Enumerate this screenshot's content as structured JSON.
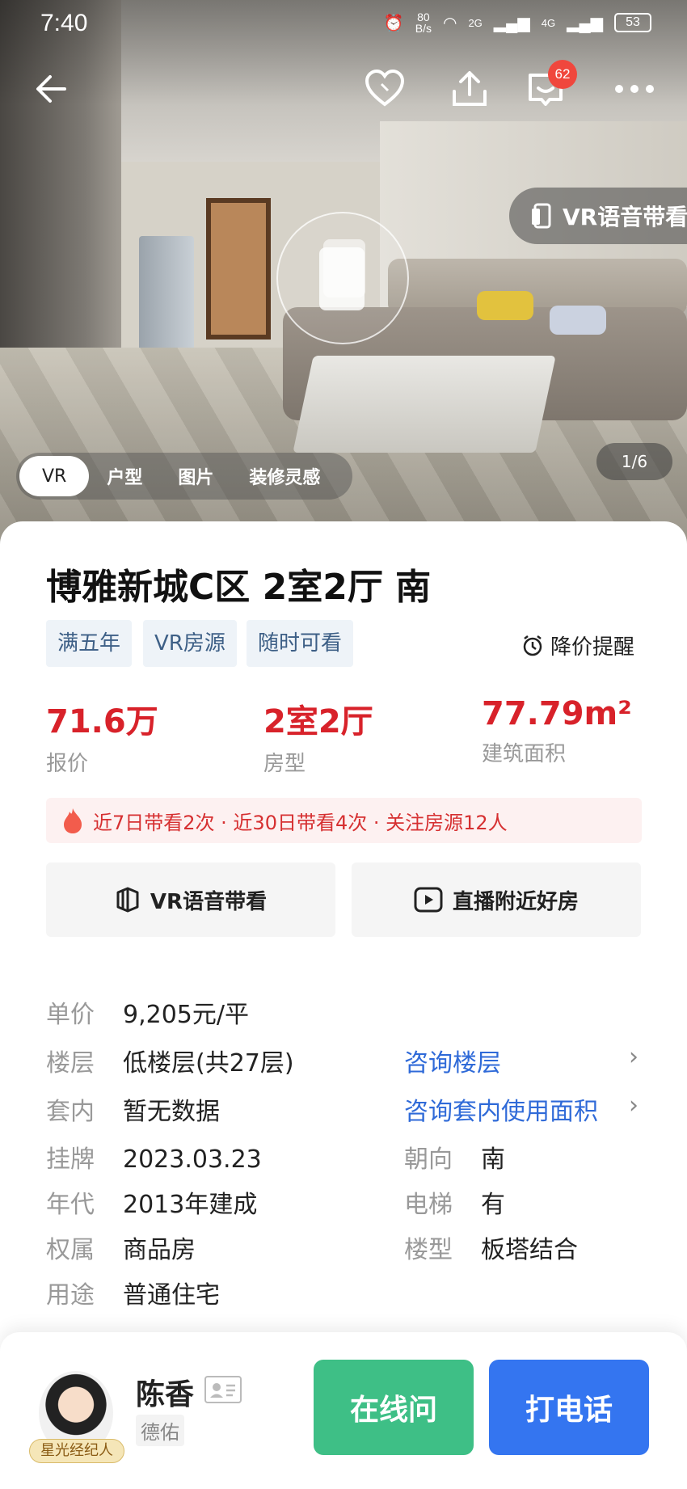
{
  "status_bar": {
    "time": "7:40",
    "net_speed": "80",
    "net_unit": "B/s",
    "signal1": "2G",
    "signal2": "4G",
    "battery": "53"
  },
  "nav": {
    "message_badge": "62",
    "icons": [
      "back-arrow-icon",
      "heart-icon",
      "share-icon",
      "message-icon",
      "more-icon"
    ]
  },
  "hero": {
    "vr_voice_label": "VR语音带看",
    "media_tabs": [
      "VR",
      "户型",
      "图片",
      "装修灵感"
    ],
    "page_indicator": "1/6"
  },
  "listing": {
    "title": "博雅新城C区 2室2厅 南",
    "tags": [
      "满五年",
      "VR房源",
      "随时可看"
    ],
    "price_alert": "降价提醒",
    "stats": [
      {
        "value": "71.6万",
        "label": "报价"
      },
      {
        "value": "2室2厅",
        "label": "房型"
      },
      {
        "value": "77.79m²",
        "label": "建筑面积"
      }
    ],
    "hot_info": "近7日带看2次 · 近30日带看4次 · 关注房源12人",
    "actions": [
      "VR语音带看",
      "直播附近好房"
    ],
    "details": {
      "unit_price": {
        "key": "单价",
        "value": "9,205元/平"
      },
      "floor": {
        "key": "楼层",
        "value": "低楼层(共27层)",
        "link": "咨询楼层"
      },
      "inner_area": {
        "key": "套内",
        "value": "暂无数据",
        "link": "咨询套内使用面积"
      },
      "listed": {
        "key": "挂牌",
        "value": "2023.03.23"
      },
      "orientation": {
        "key": "朝向",
        "value": "南"
      },
      "year": {
        "key": "年代",
        "value": "2013年建成"
      },
      "elevator": {
        "key": "电梯",
        "value": "有"
      },
      "ownership": {
        "key": "权属",
        "value": "商品房"
      },
      "building_type": {
        "key": "楼型",
        "value": "板塔结合"
      },
      "usage": {
        "key": "用途",
        "value": "普通住宅"
      }
    }
  },
  "agent": {
    "name": "陈香",
    "agency": "德佑",
    "badge": "星光经纪人",
    "chat_button": "在线问",
    "call_button": "打电话"
  },
  "colors": {
    "price_red": "#d8222a",
    "link_blue": "#2f6ad8",
    "chat_green": "#3ebf86",
    "call_blue": "#3475f0"
  }
}
